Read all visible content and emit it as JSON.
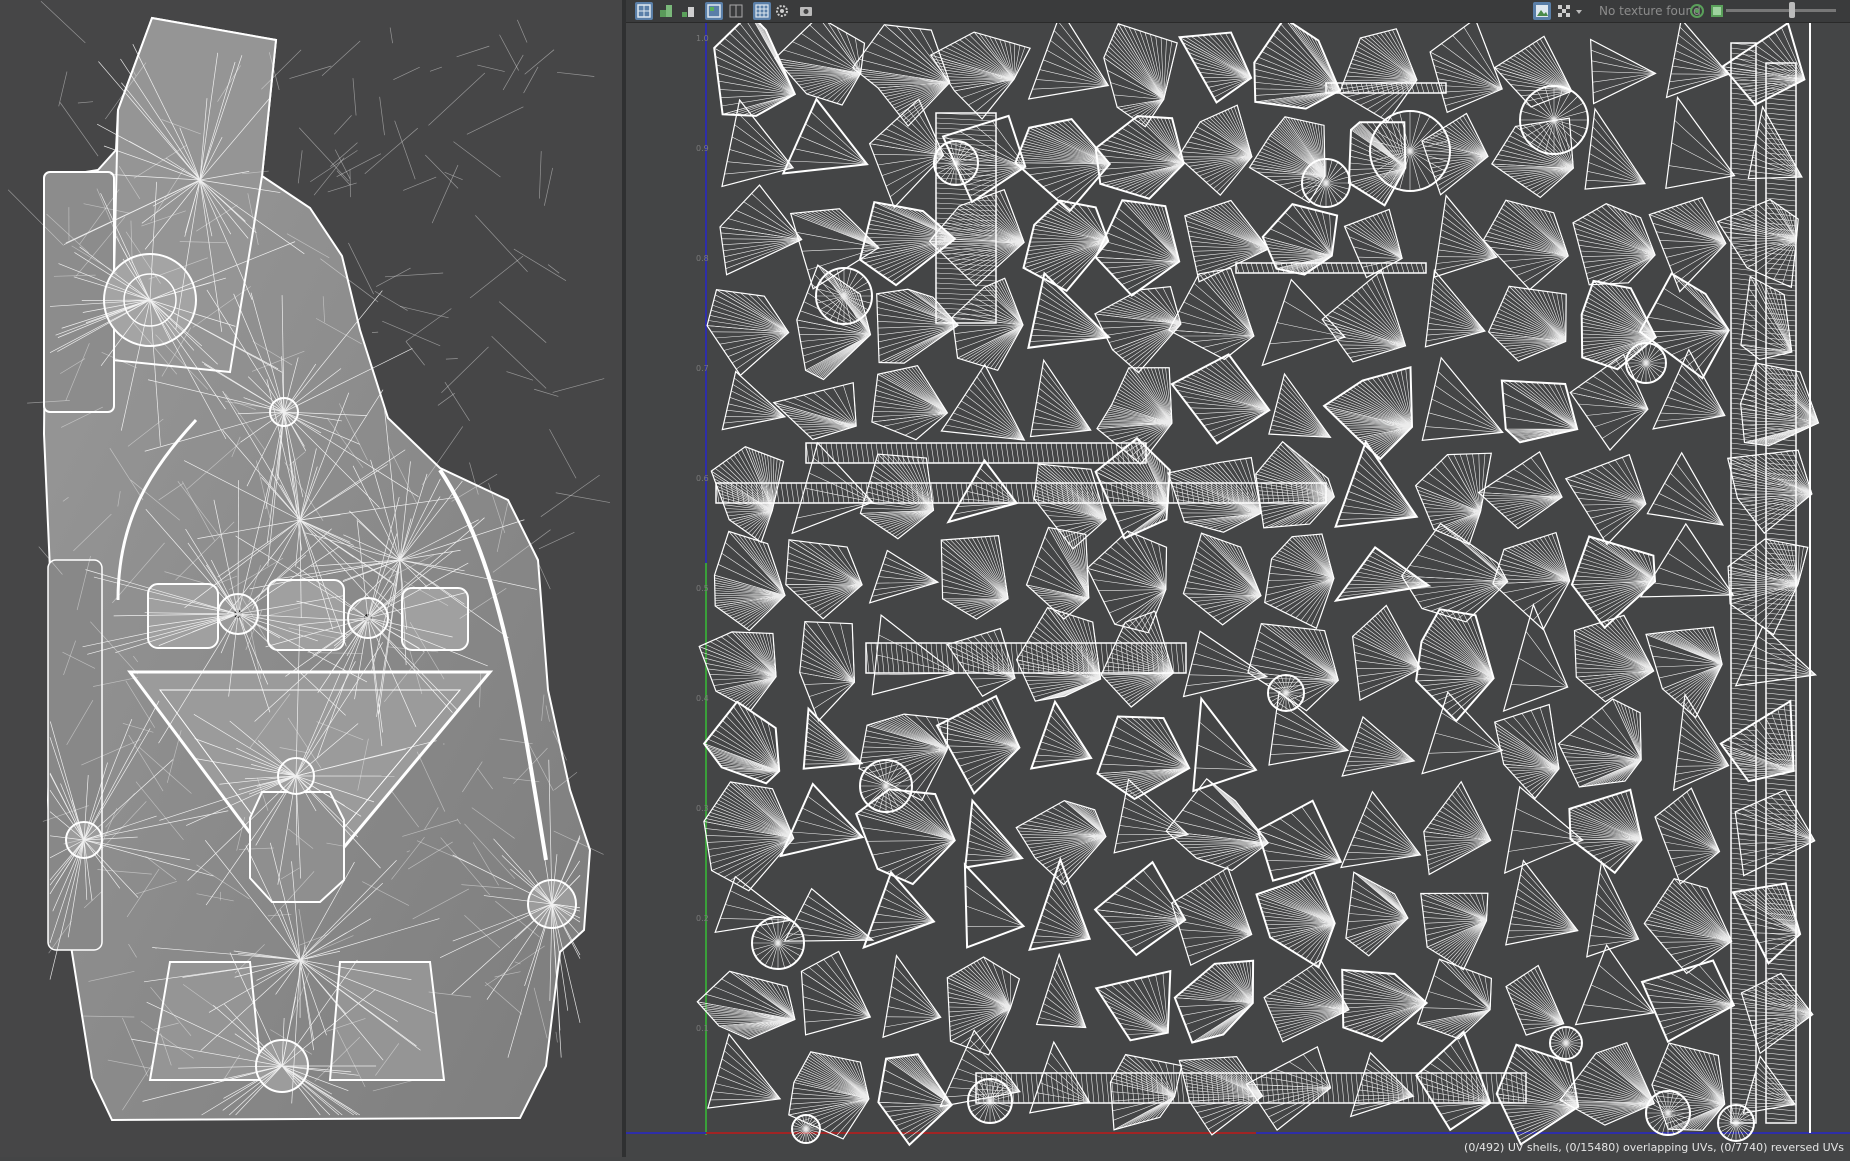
{
  "uv_toolbar": {
    "texture_status": "No texture found",
    "left_icons": [
      "uv-grid-icon",
      "shaded-uvs-icon",
      "distortion-icon",
      "checker-icon",
      "texture-borders-icon",
      "grid-icon",
      "image-settings-icon",
      "snapshot-icon"
    ],
    "right_icons": [
      "display-image-icon",
      "checker-pattern-icon",
      "dropdown-arrow-icon",
      "tile-icon",
      "image-icon"
    ]
  },
  "uv_editor": {
    "axis_labels": [
      "1.0",
      "0.9",
      "0.8",
      "0.7",
      "0.6",
      "0.5",
      "0.4",
      "0.3",
      "0.2",
      "0.1"
    ],
    "status_text": "(0/492) UV shells, (0/15480) overlapping UVs, (0/7740) reversed UVs"
  },
  "colors": {
    "viewport_bg": "#464647",
    "mesh_fill": "#8a8a8a",
    "wireframe": "#ffffff",
    "uv_bg": "#444546",
    "v_axis": "#2e2ea8",
    "u_axis_left": "#a02424",
    "u_axis_right": "#2e2ea8",
    "active_tool": "#5a7fa8"
  }
}
